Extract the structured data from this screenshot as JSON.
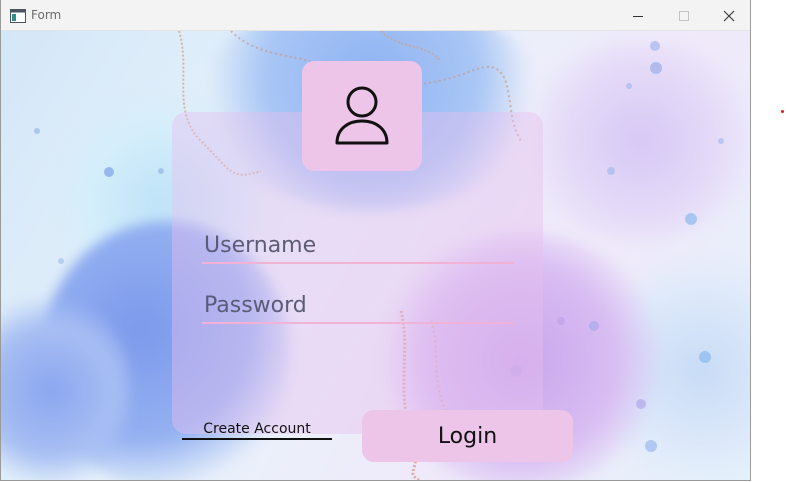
{
  "window": {
    "title": "Form",
    "icons": {
      "app": "window-app-icon",
      "minimize": "minimize-icon",
      "maximize": "maximize-icon",
      "close": "close-icon"
    }
  },
  "form": {
    "avatar_icon": "user-icon",
    "username": {
      "value": "",
      "placeholder": "Username"
    },
    "password": {
      "value": "",
      "placeholder": "Password"
    },
    "create_account_label": "Create Account",
    "login_label": "Login"
  },
  "colors": {
    "card": "#e8beee",
    "button": "#ecc5e9",
    "field_underline": "#f2b2d6",
    "placeholder": "#5c5b78"
  }
}
